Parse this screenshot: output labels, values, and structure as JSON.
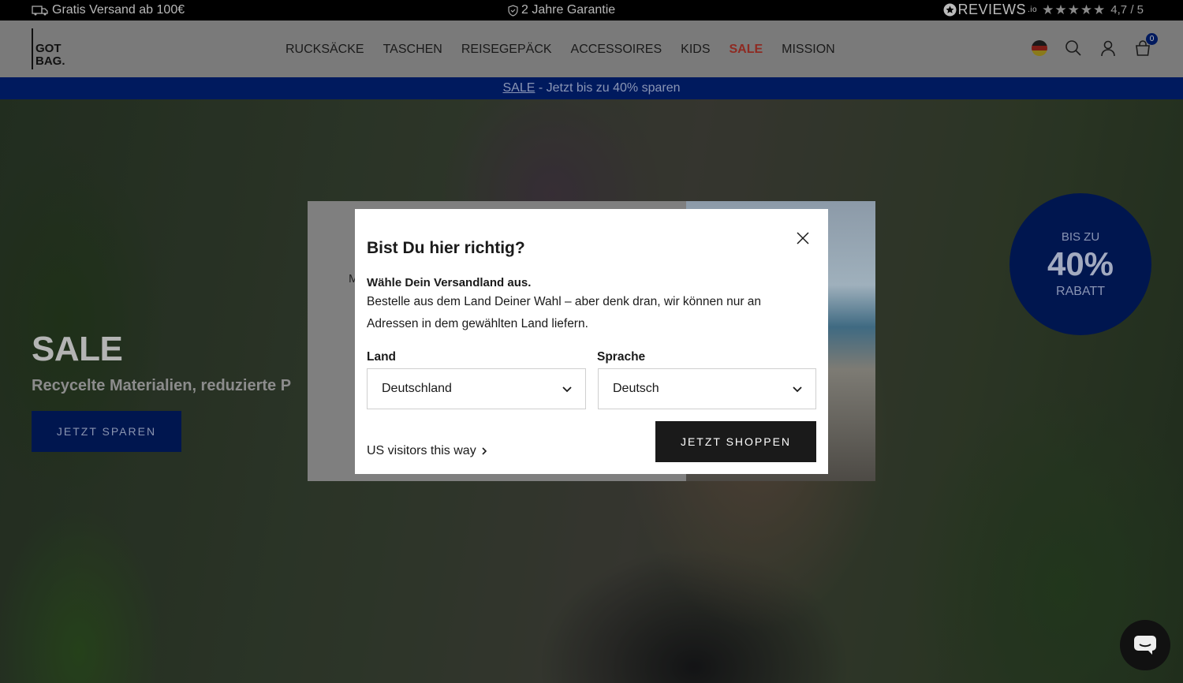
{
  "topbar": {
    "shipping": "Gratis Versand ab 100€",
    "guarantee": "2 Jahre Garantie",
    "reviews_brand": "REVIEWS",
    "reviews_suffix": ".io",
    "stars": "★★★★★",
    "rating": "4,7 / 5"
  },
  "header": {
    "logo_line1": "GOT",
    "logo_line2": "BAG.",
    "nav": [
      "RUCKSÄCKE",
      "TASCHEN",
      "REISEGEPÄCK",
      "ACCESSOIRES",
      "KIDS",
      "SALE",
      "MISSION"
    ],
    "cart_count": "0",
    "icons": [
      "flag-germany-icon",
      "search-icon",
      "user-icon",
      "cart-icon"
    ]
  },
  "promo": {
    "link": "SALE",
    "text": " - Jetzt bis zu 40% sparen"
  },
  "hero": {
    "title": "SALE",
    "subtitle": "Recycelte Materialien, reduzierte P",
    "button": "JETZT SPAREN",
    "badge_line1": "BIS ZU",
    "badge_line2": "40%",
    "badge_line3": "RABATT"
  },
  "under_popup": {
    "fragment": "M"
  },
  "modal": {
    "title": "Bist Du hier richtig?",
    "subtitle": "Wähle Dein Versandland aus.",
    "text": "Bestelle aus dem Land Deiner Wahl – aber denk dran, wir können nur an Adressen in dem gewählten Land liefern.",
    "country_label": "Land",
    "country_value": "Deutschland",
    "language_label": "Sprache",
    "language_value": "Deutsch",
    "us_link": "US visitors this way",
    "shop_button": "JETZT SHOPPEN"
  },
  "colors": {
    "navy": "#001a5e",
    "sale_red": "#8e2a22",
    "modal_button": "#1a1a1a"
  }
}
